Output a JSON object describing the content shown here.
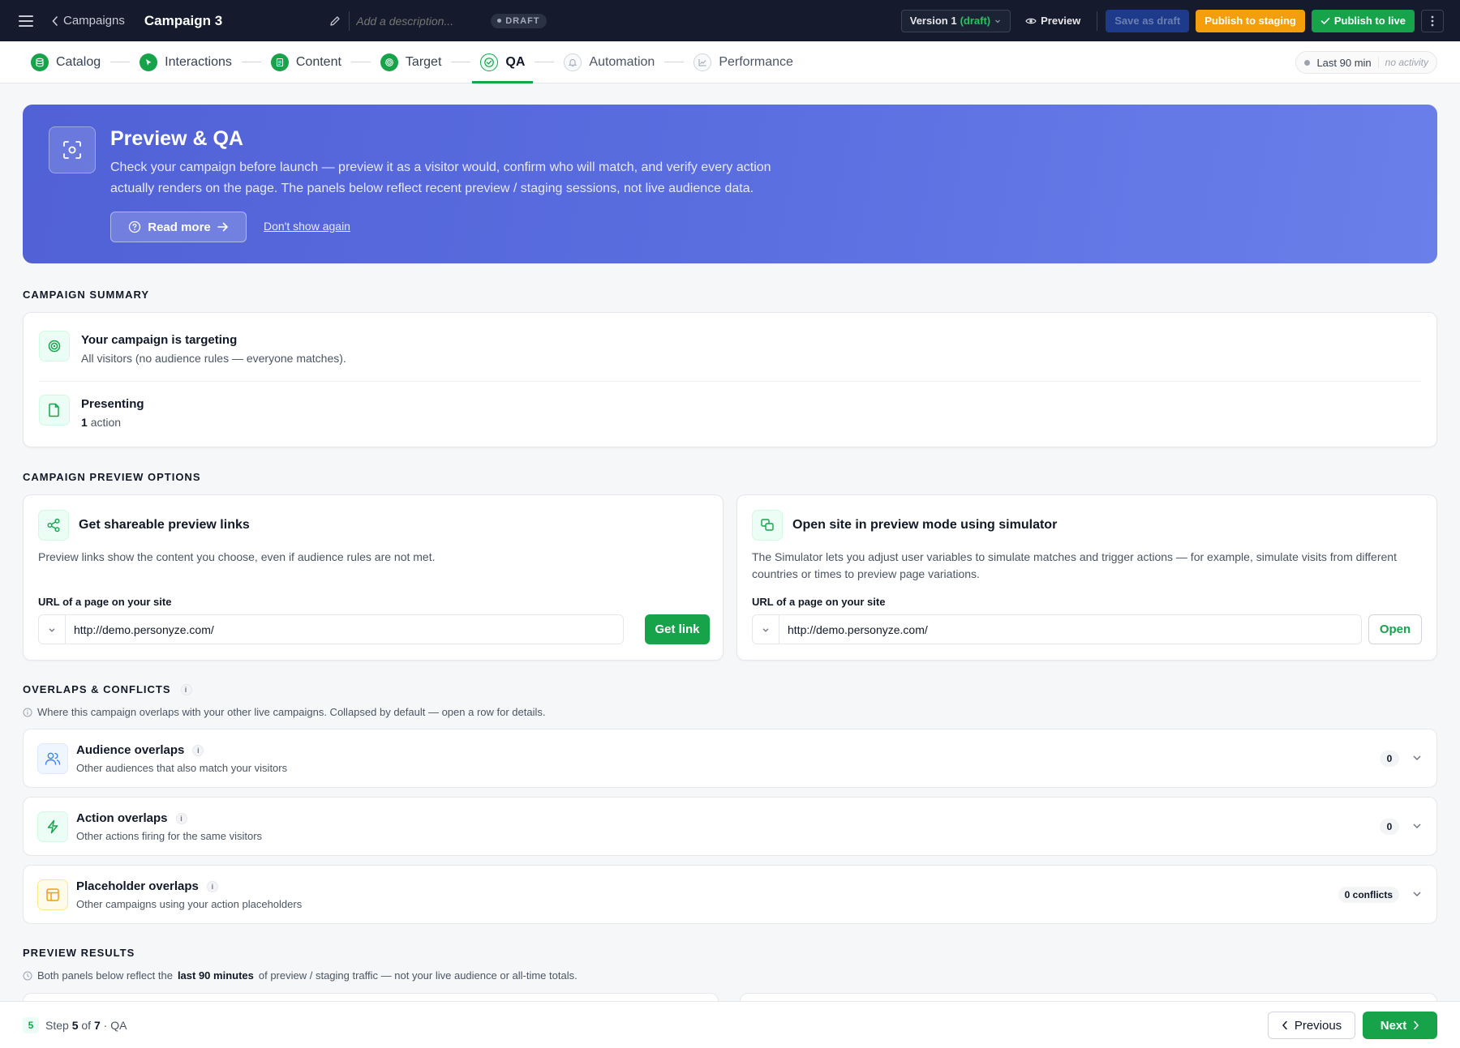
{
  "topbar": {
    "back_label": "Campaigns",
    "campaign_title": "Campaign 3",
    "description_placeholder": "Add a description...",
    "draft_badge": "DRAFT",
    "version_label": "Version 1",
    "version_state": "(draft)",
    "preview_label": "Preview",
    "save_draft_label": "Save as draft",
    "publish_staging_label": "Publish to staging",
    "publish_live_label": "Publish to live"
  },
  "steps": [
    {
      "label": "Catalog",
      "state": "done",
      "icon": "database-icon"
    },
    {
      "label": "Interactions",
      "state": "done",
      "icon": "cursor-icon"
    },
    {
      "label": "Content",
      "state": "done",
      "icon": "document-icon"
    },
    {
      "label": "Target",
      "state": "done",
      "icon": "target-icon"
    },
    {
      "label": "QA",
      "state": "active",
      "icon": "check-circle-icon"
    },
    {
      "label": "Automation",
      "state": "todo",
      "icon": "bell-icon"
    },
    {
      "label": "Performance",
      "state": "todo",
      "icon": "chart-icon"
    }
  ],
  "activity": {
    "range": "Last 90 min",
    "status": "no activity"
  },
  "hero": {
    "title": "Preview & QA",
    "text": "Check your campaign before launch — preview it as a visitor would, confirm who will match, and verify every action actually renders on the page. The panels below reflect recent preview / staging sessions, not live audience data.",
    "read_more": "Read more",
    "dont_show": "Don't show again"
  },
  "summary": {
    "heading": "CAMPAIGN SUMMARY",
    "targeting_title": "Your campaign is targeting",
    "targeting_sub": "All visitors (no audience rules — everyone matches).",
    "presenting_title": "Presenting",
    "presenting_count": "1",
    "presenting_unit": "action"
  },
  "preview_options": {
    "heading": "CAMPAIGN PREVIEW OPTIONS",
    "share": {
      "title": "Get shareable preview links",
      "desc": "Preview links show the content you choose, even if audience rules are not met.",
      "url_label": "URL of a page on your site",
      "url_value": "http://demo.personyze.com/",
      "button": "Get link"
    },
    "simulator": {
      "title": "Open site in preview mode using simulator",
      "desc": "The Simulator lets you adjust user variables to simulate matches and trigger actions — for example, simulate visits from different countries or times to preview page variations.",
      "url_label": "URL of a page on your site",
      "url_value": "http://demo.personyze.com/",
      "button": "Open"
    }
  },
  "overlaps": {
    "heading": "OVERLAPS & CONFLICTS",
    "info": "i",
    "hint": "Where this campaign overlaps with your other live campaigns. Collapsed by default — open a row for details.",
    "rows": [
      {
        "title": "Audience overlaps",
        "sub": "Other audiences that also match your visitors",
        "count": "0"
      },
      {
        "title": "Action overlaps",
        "sub": "Other actions firing for the same visitors",
        "count": "0"
      },
      {
        "title": "Placeholder overlaps",
        "sub": "Other campaigns using your action placeholders",
        "count": "0 conflicts"
      }
    ]
  },
  "results": {
    "heading": "PREVIEW RESULTS",
    "hint_pre": "Both panels below reflect the",
    "hint_bold": "last 90 minutes",
    "hint_post": "of preview / staging traffic — not your live audience or all-time totals."
  },
  "footer": {
    "step_number": "5",
    "step_word": "Step",
    "current": "5",
    "of_word": "of",
    "total": "7",
    "step_name": "· QA",
    "previous": "Previous",
    "next": "Next"
  },
  "colors": {
    "accent": "#16a34a",
    "topbar": "#151b2c",
    "hero": "#5a6ee0",
    "staging": "#f59e0b"
  }
}
